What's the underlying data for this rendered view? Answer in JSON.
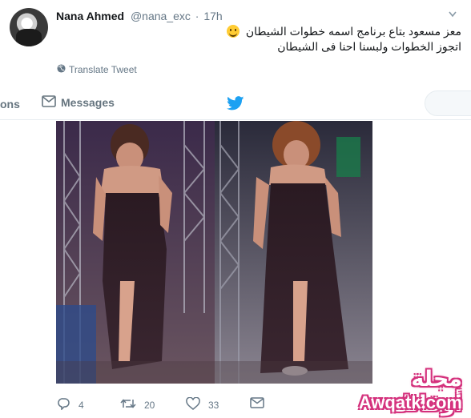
{
  "tweet": {
    "display_name": "Nana Ahmed",
    "handle": "@nana_exc",
    "separator": "·",
    "time": "17h",
    "text_line1": "معز مسعود بتاع برنامج اسمه خطوات الشيطان",
    "text_line2": "اتجوز الخطوات ولبسنا احنا فى الشيطان",
    "translate_label": "Translate Tweet"
  },
  "navbar": {
    "notifications_partial": "ons",
    "messages_label": "Messages"
  },
  "actions": {
    "replies": "4",
    "retweets": "20",
    "likes": "33"
  },
  "watermark": {
    "arabic": "مجلة أوقاتك",
    "latin": "Awqatk.com"
  },
  "colors": {
    "twitter_blue": "#1da1f2",
    "muted": "#657786",
    "watermark_pink": "#d4327d"
  },
  "icons": [
    "avatar",
    "caret-down-icon",
    "emoji-grin-icon",
    "globe-icon",
    "envelope-icon",
    "twitter-bird-icon",
    "reply-icon",
    "retweet-icon",
    "heart-icon",
    "direct-message-icon"
  ]
}
